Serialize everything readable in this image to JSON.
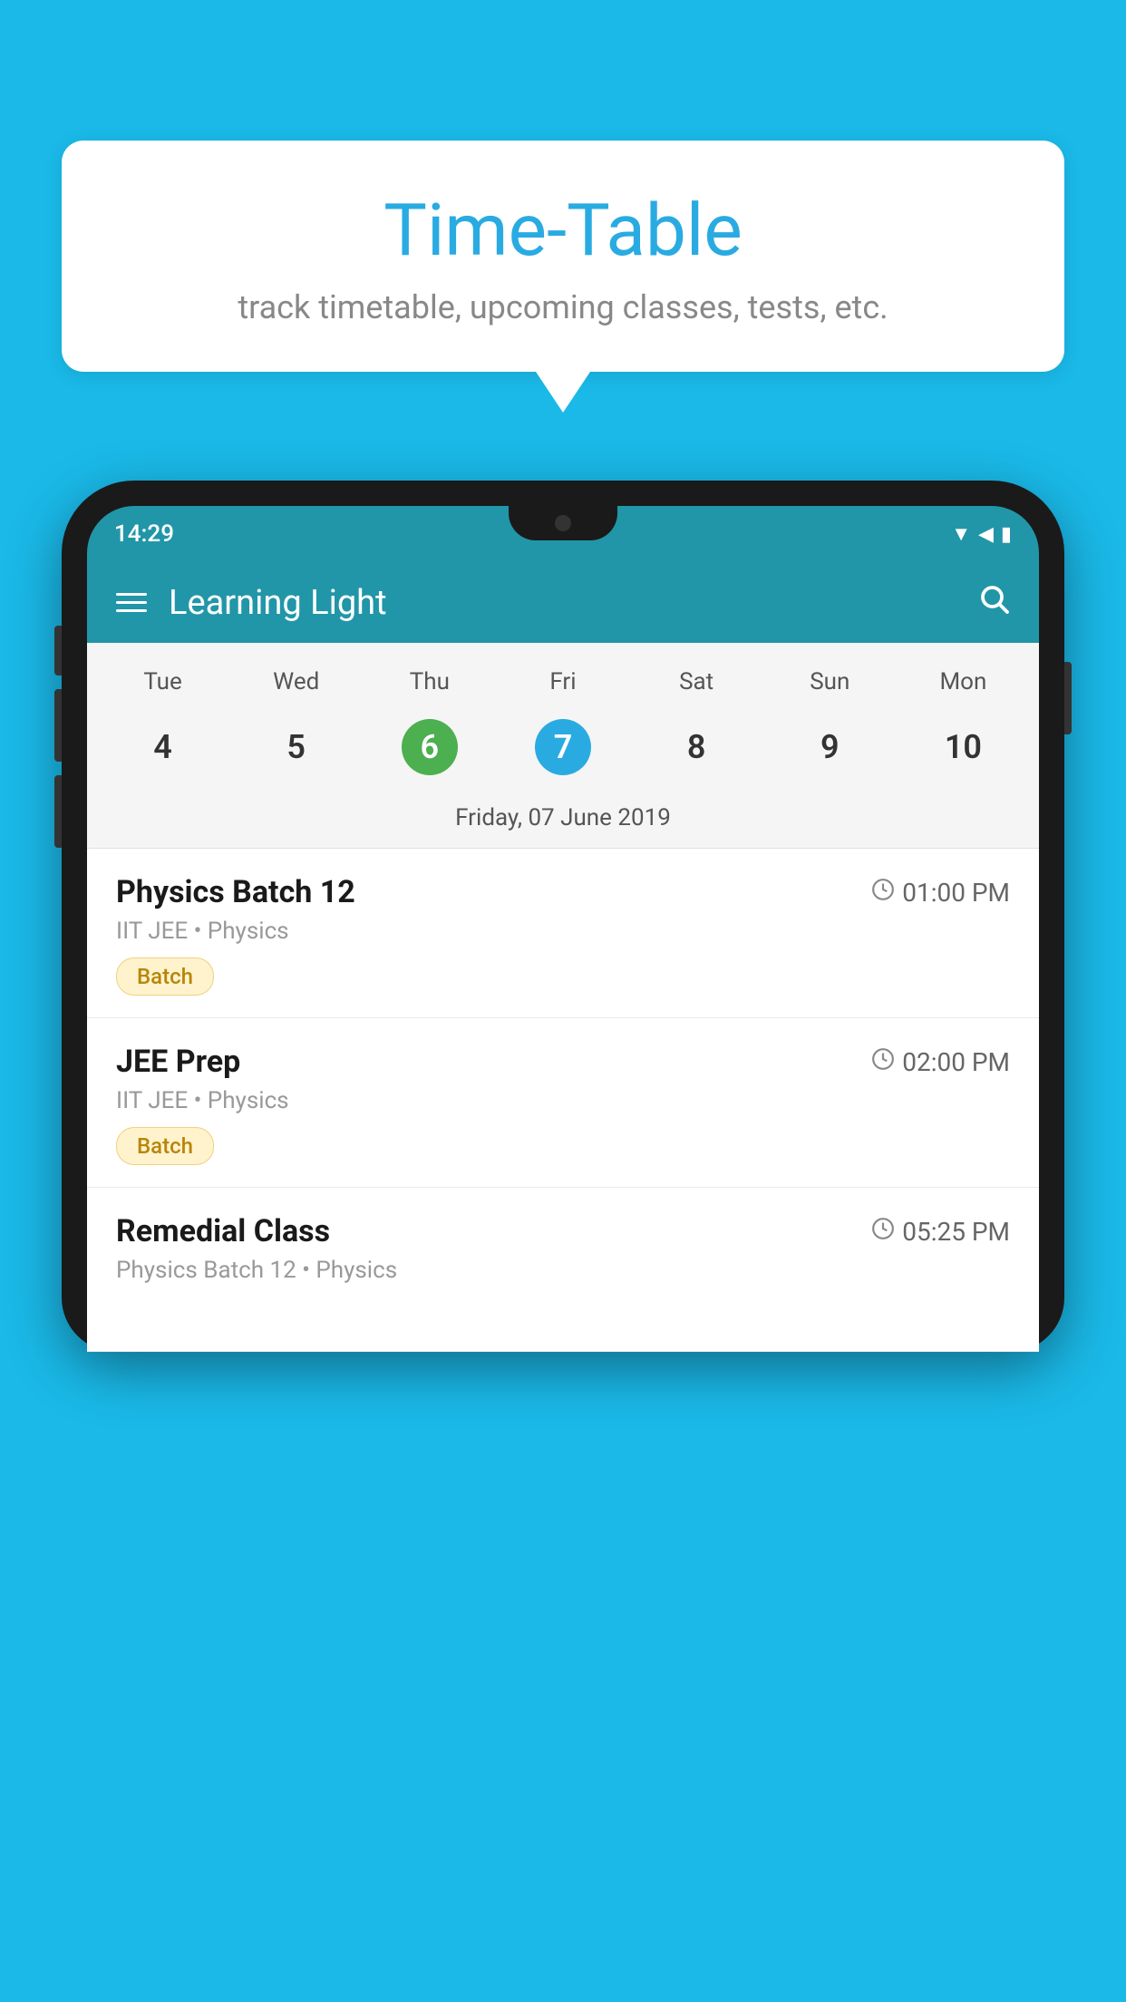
{
  "background_color": "#1ab9e8",
  "speech_bubble": {
    "title": "Time-Table",
    "subtitle": "track timetable, upcoming classes, tests, etc."
  },
  "phone": {
    "status_bar": {
      "time": "14:29"
    },
    "app_header": {
      "title": "Learning Light"
    },
    "calendar": {
      "days": [
        "Tue",
        "Wed",
        "Thu",
        "Fri",
        "Sat",
        "Sun",
        "Mon"
      ],
      "dates": [
        "4",
        "5",
        "6",
        "7",
        "8",
        "9",
        "10"
      ],
      "today_index": 2,
      "selected_index": 3,
      "selected_date_label": "Friday, 07 June 2019"
    },
    "schedule_items": [
      {
        "name": "Physics Batch 12",
        "time": "01:00 PM",
        "tags": "IIT JEE • Physics",
        "badge": "Batch"
      },
      {
        "name": "JEE Prep",
        "time": "02:00 PM",
        "tags": "IIT JEE • Physics",
        "badge": "Batch"
      },
      {
        "name": "Remedial Class",
        "time": "05:25 PM",
        "tags": "Physics Batch 12 • Physics",
        "badge": null
      }
    ]
  }
}
